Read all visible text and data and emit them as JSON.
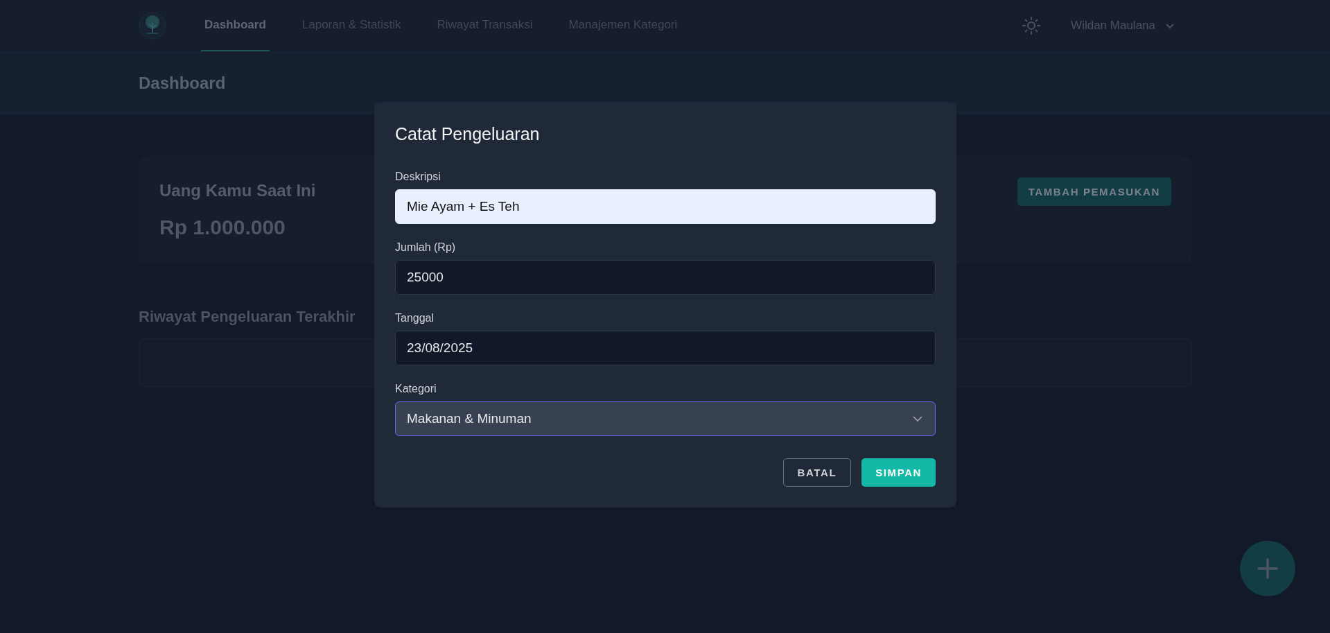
{
  "nav": {
    "tabs": [
      {
        "label": "Dashboard",
        "selected": true
      },
      {
        "label": "Laporan & Statistik",
        "selected": false
      },
      {
        "label": "Riwayat Transaksi",
        "selected": false
      },
      {
        "label": "Manajemen Kategori",
        "selected": false
      }
    ],
    "user": "Wildan Maulana"
  },
  "page_title": "Dashboard",
  "balance_card": {
    "label": "Uang Kamu Saat Ini",
    "amount": "Rp 1.000.000",
    "button": "TAMBAH PEMASUKAN"
  },
  "recent": {
    "title": "Riwayat Pengeluaran Terakhir"
  },
  "modal": {
    "title": "Catat Pengeluaran",
    "fields": [
      {
        "kind": "text",
        "label": "Deskripsi",
        "value": "Mie Ayam + Es Teh",
        "autofilled": true,
        "focused": false
      },
      {
        "kind": "text",
        "label": "Jumlah (Rp)",
        "value": "25000",
        "autofilled": false,
        "focused": false
      },
      {
        "kind": "text",
        "label": "Tanggal",
        "value": "23/08/2025",
        "autofilled": false,
        "focused": false
      },
      {
        "kind": "select",
        "label": "Kategori",
        "value": "Makanan & Minuman",
        "autofilled": false,
        "focused": true
      }
    ],
    "buttons": [
      {
        "kind": "secondary",
        "label": "BATAL"
      },
      {
        "kind": "primary",
        "label": "SIMPAN"
      }
    ]
  }
}
